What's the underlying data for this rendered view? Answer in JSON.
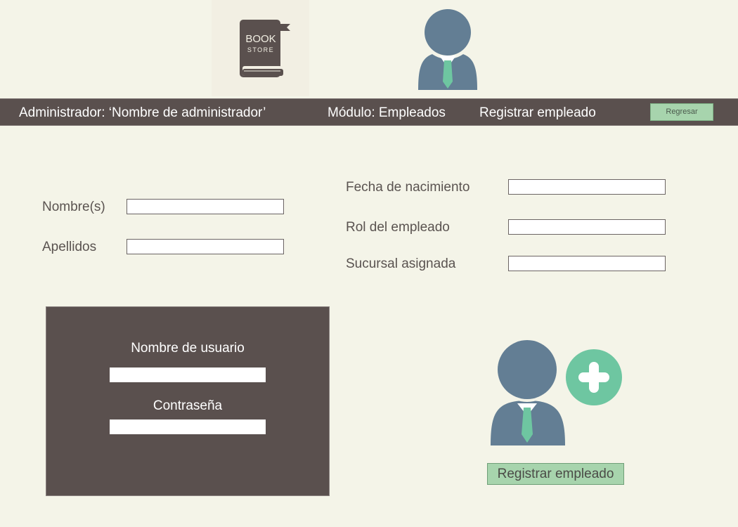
{
  "logo": {
    "line1": "BOOK",
    "line2": "STORE"
  },
  "topbar": {
    "admin_text": "Administrador: ‘Nombre de administrador’",
    "module_text": "Módulo: Empleados",
    "screen_text": "Registrar empleado",
    "back_button": "Regresar"
  },
  "form": {
    "nombres_label": "Nombre(s)",
    "nombres_value": "",
    "apellidos_label": "Apellidos",
    "apellidos_value": "",
    "fecha_label": "Fecha de nacimiento",
    "fecha_value": "",
    "rol_label": "Rol del empleado",
    "rol_value": "",
    "sucursal_label": "Sucursal asignada",
    "sucursal_value": ""
  },
  "credentials": {
    "username_label": "Nombre de usuario",
    "username_value": "",
    "password_label": "Contraseña",
    "password_value": ""
  },
  "actions": {
    "register_button": "Registrar empleado"
  },
  "colors": {
    "background": "#f4f4e8",
    "bar": "#5a504e",
    "accent_green": "#a7d4ad",
    "avatar_blue": "#637e94",
    "tie_green": "#6ec6a1",
    "plus_green": "#6ec6a1"
  },
  "icons": {
    "logo": "book-icon",
    "header_user": "user-icon",
    "add_user": "add-user-icon"
  }
}
